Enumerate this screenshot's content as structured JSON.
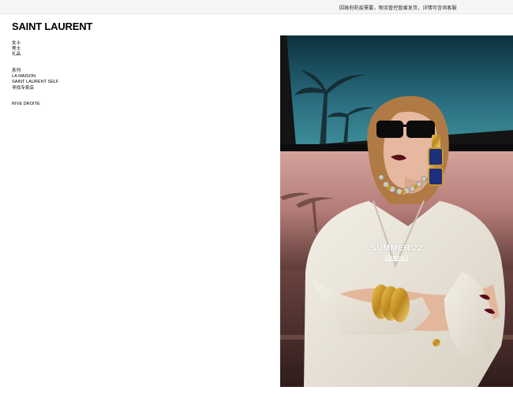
{
  "notice": {
    "text": "因政府防疫需要，物流管控暂缓发货，详情可咨询客服"
  },
  "brand": {
    "logo": "SAINT LAURENT"
  },
  "nav": {
    "group1": [
      "女士",
      "男士",
      "礼品"
    ],
    "group2": [
      "系列",
      "LA MAISON",
      "SAINT LAURENT SELF",
      "寻找专卖店"
    ],
    "group3": [
      "RIVE DROITE"
    ]
  },
  "hero": {
    "title": "SUMMER 22",
    "cta": "探索精选单品"
  },
  "colors": {
    "sky_top": "#0f3a4a",
    "sky_mid": "#2c6f80",
    "sunset": "#c7908a",
    "car_body": "#4a2e2c",
    "jacket": "#ece7dc",
    "gold": "#c89a2e"
  }
}
